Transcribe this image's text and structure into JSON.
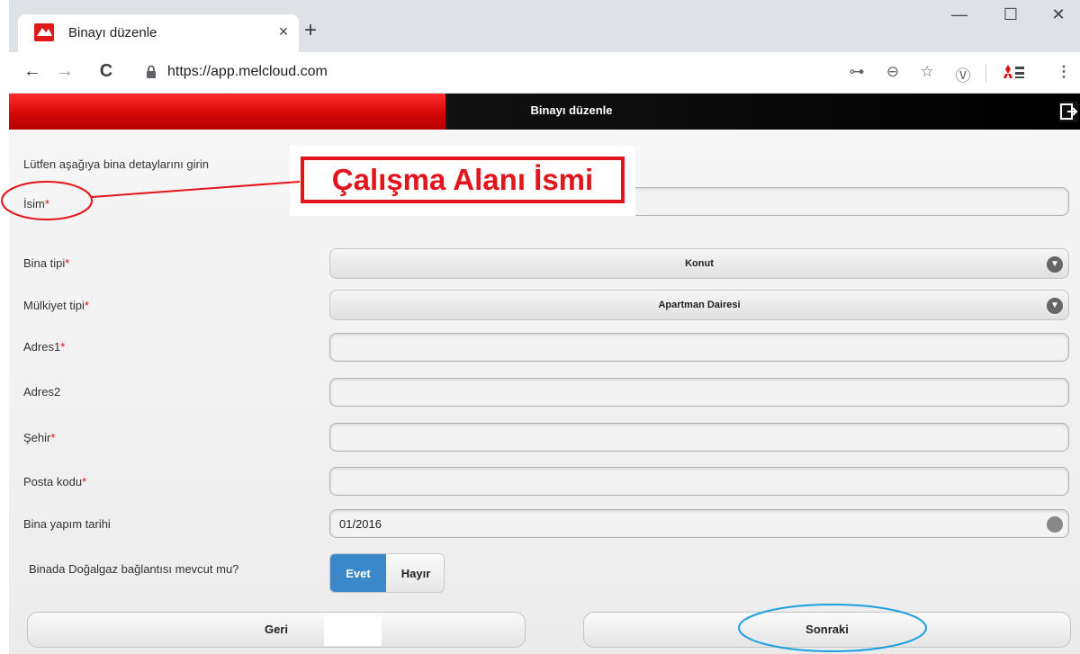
{
  "browser": {
    "tab_title": "Binayı düzenle",
    "tab_close": "×",
    "new_tab": "+",
    "url": "https://app.melcloud.com",
    "window_controls": {
      "minimize": "—",
      "maximize": "☐",
      "close": "✕"
    },
    "icons": {
      "back": "←",
      "forward": "→",
      "reload": "C",
      "key": "⊶",
      "zoom": "⊖",
      "star": "☆",
      "ext": "Ⓥ",
      "menu": "⋮"
    }
  },
  "app": {
    "header_title": "Binayı düzenle",
    "accent_red": "#e01a1a",
    "accent_blue": "#3a87c9"
  },
  "form": {
    "intro": "Lütfen aşağıya bina detaylarını girin",
    "isim_label": "İsim",
    "bina_tipi_label": "Bina tipi",
    "bina_tipi_value": "Konut",
    "mulkiyet_label": "Mülkiyet tipi",
    "mulkiyet_value": "Apartman Dairesi",
    "adres1_label": "Adres1",
    "adres2_label": "Adres2",
    "sehir_label": "Şehir",
    "posta_label": "Posta kodu",
    "yapim_label": "Bina yapım tarihi",
    "yapim_value": "01/2016",
    "dogalgaz_label": "Binada Doğalgaz bağlantısı mevcut mu?",
    "evet": "Evet",
    "hayir": "Hayır",
    "required_mark": "*",
    "back_button": "Geri",
    "next_button": "Sonraki"
  },
  "annotation": {
    "callout": "Çalışma Alanı İsmi",
    "color": "#e3141b",
    "highlight_color": "#1ea0e0"
  }
}
